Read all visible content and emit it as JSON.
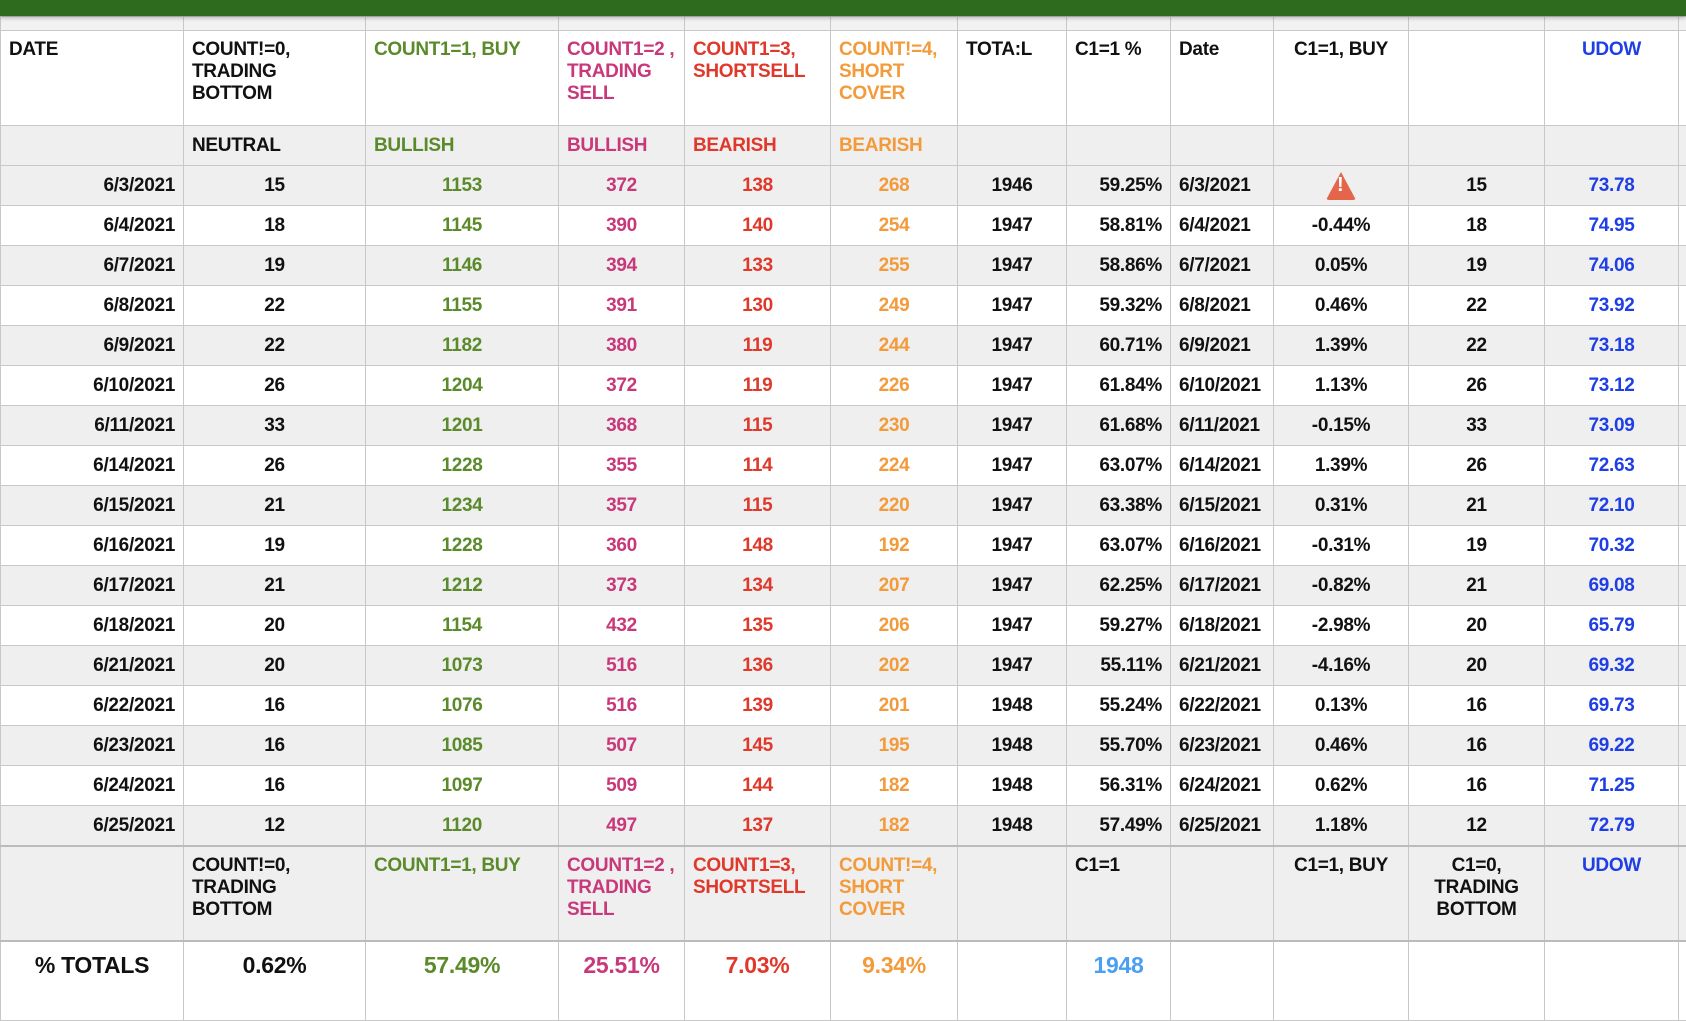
{
  "colors": {
    "topbar": "#2e6b1e",
    "buy": "#5a8a2a",
    "sell": "#c8387a",
    "short": "#e0382a",
    "cover": "#f39a3a",
    "udow": "#1f3fe6",
    "c1": "#4a9ff0"
  },
  "header": [
    "DATE",
    "COUNT!=0, TRADING BOTTOM",
    "COUNT1=1, BUY",
    "COUNT1=2 , TRADING SELL",
    "COUNT1=3, SHORTSELL",
    "COUNT!=4, SHORT COVER",
    "TOTA:L",
    "C1=1 %",
    "Date",
    "C1=1, BUY",
    "",
    "UDOW"
  ],
  "subheader": [
    "",
    "NEUTRAL",
    "BULLISH",
    "BULLISH",
    "BEARISH",
    "BEARISH",
    "",
    "",
    "",
    "",
    "",
    ""
  ],
  "rows": [
    [
      "6/3/2021",
      "15",
      "1153",
      "372",
      "138",
      "268",
      "1946",
      "59.25%",
      "6/3/2021",
      "",
      "15",
      "73.78"
    ],
    [
      "6/4/2021",
      "18",
      "1145",
      "390",
      "140",
      "254",
      "1947",
      "58.81%",
      "6/4/2021",
      "-0.44%",
      "18",
      "74.95"
    ],
    [
      "6/7/2021",
      "19",
      "1146",
      "394",
      "133",
      "255",
      "1947",
      "58.86%",
      "6/7/2021",
      "0.05%",
      "19",
      "74.06"
    ],
    [
      "6/8/2021",
      "22",
      "1155",
      "391",
      "130",
      "249",
      "1947",
      "59.32%",
      "6/8/2021",
      "0.46%",
      "22",
      "73.92"
    ],
    [
      "6/9/2021",
      "22",
      "1182",
      "380",
      "119",
      "244",
      "1947",
      "60.71%",
      "6/9/2021",
      "1.39%",
      "22",
      "73.18"
    ],
    [
      "6/10/2021",
      "26",
      "1204",
      "372",
      "119",
      "226",
      "1947",
      "61.84%",
      "6/10/2021",
      "1.13%",
      "26",
      "73.12"
    ],
    [
      "6/11/2021",
      "33",
      "1201",
      "368",
      "115",
      "230",
      "1947",
      "61.68%",
      "6/11/2021",
      "-0.15%",
      "33",
      "73.09"
    ],
    [
      "6/14/2021",
      "26",
      "1228",
      "355",
      "114",
      "224",
      "1947",
      "63.07%",
      "6/14/2021",
      "1.39%",
      "26",
      "72.63"
    ],
    [
      "6/15/2021",
      "21",
      "1234",
      "357",
      "115",
      "220",
      "1947",
      "63.38%",
      "6/15/2021",
      "0.31%",
      "21",
      "72.10"
    ],
    [
      "6/16/2021",
      "19",
      "1228",
      "360",
      "148",
      "192",
      "1947",
      "63.07%",
      "6/16/2021",
      "-0.31%",
      "19",
      "70.32"
    ],
    [
      "6/17/2021",
      "21",
      "1212",
      "373",
      "134",
      "207",
      "1947",
      "62.25%",
      "6/17/2021",
      "-0.82%",
      "21",
      "69.08"
    ],
    [
      "6/18/2021",
      "20",
      "1154",
      "432",
      "135",
      "206",
      "1947",
      "59.27%",
      "6/18/2021",
      "-2.98%",
      "20",
      "65.79"
    ],
    [
      "6/21/2021",
      "20",
      "1073",
      "516",
      "136",
      "202",
      "1947",
      "55.11%",
      "6/21/2021",
      "-4.16%",
      "20",
      "69.32"
    ],
    [
      "6/22/2021",
      "16",
      "1076",
      "516",
      "139",
      "201",
      "1948",
      "55.24%",
      "6/22/2021",
      "0.13%",
      "16",
      "69.73"
    ],
    [
      "6/23/2021",
      "16",
      "1085",
      "507",
      "145",
      "195",
      "1948",
      "55.70%",
      "6/23/2021",
      "0.46%",
      "16",
      "69.22"
    ],
    [
      "6/24/2021",
      "16",
      "1097",
      "509",
      "144",
      "182",
      "1948",
      "56.31%",
      "6/24/2021",
      "0.62%",
      "16",
      "71.25"
    ],
    [
      "6/25/2021",
      "12",
      "1120",
      "497",
      "137",
      "182",
      "1948",
      "57.49%",
      "6/25/2021",
      "1.18%",
      "12",
      "72.79"
    ]
  ],
  "warning_row": 0,
  "footer_header": [
    "",
    "COUNT!=0, TRADING BOTTOM",
    "COUNT1=1, BUY",
    "COUNT1=2 , TRADING SELL",
    "COUNT1=3, SHORTSELL",
    "COUNT!=4, SHORT COVER",
    "",
    "C1=1",
    "",
    "C1=1, BUY",
    "C1=0, TRADING BOTTOM",
    "UDOW"
  ],
  "totals": [
    "% TOTALS",
    "0.62%",
    "57.49%",
    "25.51%",
    "7.03%",
    "9.34%",
    "",
    "1948",
    "",
    "",
    "",
    ""
  ]
}
